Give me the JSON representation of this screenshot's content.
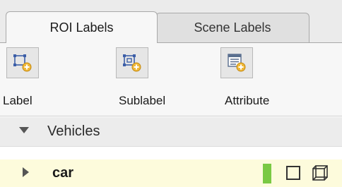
{
  "tabs": [
    {
      "label": "ROI Labels",
      "active": true
    },
    {
      "label": "Scene Labels",
      "active": false
    }
  ],
  "toolbar": {
    "items": [
      {
        "label": "Label",
        "icon": "add-rectangle-label-icon"
      },
      {
        "label": "Sublabel",
        "icon": "add-sublabel-icon"
      },
      {
        "label": "Attribute",
        "icon": "add-attribute-icon"
      }
    ]
  },
  "labels_panel": {
    "group_name": "Vehicles",
    "group_expanded": true,
    "items": [
      {
        "name": "car",
        "color": "#7ac943",
        "shape_icons": [
          "rectangle-icon",
          "cuboid-icon"
        ]
      }
    ]
  },
  "colors": {
    "accent_plus": "#f0b93a",
    "label_color": "#7ac943",
    "selected_row": "#fdfbdc"
  }
}
